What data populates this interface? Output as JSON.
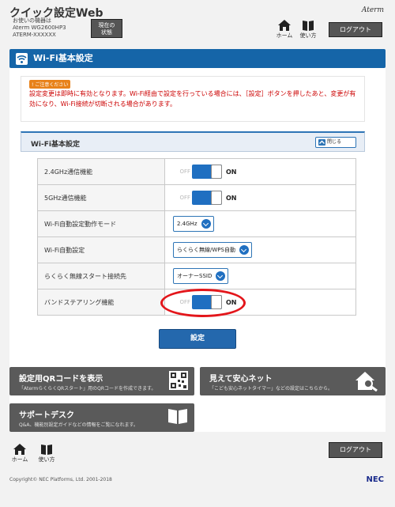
{
  "header": {
    "app_title": "クイック設定Web",
    "device_lines": [
      "お使いの機器は",
      "Aterm WG2600HP3",
      "ATERM-XXXXXX"
    ],
    "status_button": [
      "現在の",
      "状態"
    ],
    "brand": "Aterm",
    "home_label": "ホーム",
    "help_label": "使い方",
    "logout_label": "ログアウト"
  },
  "page_title": "Wi-Fi基本設定",
  "caution": {
    "badge": "ご注意ください",
    "text": "設定変更は即時に有効となります。Wi-Fi経由で設定を行っている場合には、［設定］ボタンを押したあと、変更が有効になり、Wi-Fi接続が切断される場合があります。"
  },
  "section": {
    "title": "Wi-Fi基本設定",
    "close_label": "閉じる"
  },
  "settings": {
    "row0": {
      "label": "2.4GHz通信機能",
      "off": "OFF",
      "on": "ON",
      "enabled": true
    },
    "row1": {
      "label": "5GHz通信機能",
      "off": "OFF",
      "on": "ON",
      "enabled": true
    },
    "row2": {
      "label": "Wi-Fi自動設定動作モード",
      "value": "2.4GHz"
    },
    "row3": {
      "label": "Wi-Fi自動設定",
      "value": "らくらく無線/WPS自動"
    },
    "row4": {
      "label": "らくらく無線スタート接続先",
      "value": "オーナーSSID"
    },
    "row5": {
      "label": "バンドステアリング機能",
      "off": "OFF",
      "on": "ON",
      "enabled": true
    }
  },
  "apply_button": "設定",
  "cards": {
    "qr": {
      "title": "設定用QRコードを表示",
      "desc": "「AtermらくらくQRスタート」用のQRコードを作成できます。",
      "icon": "qr-code-icon"
    },
    "safe": {
      "title": "見えて安心ネット",
      "desc": "「こども安心ネットタイマー」などの設定はこちらから。",
      "icon": "house-search-icon"
    },
    "support": {
      "title": "サポートデスク",
      "desc": "Q&A、機能別設定ガイドなどの情報をご覧になれます。",
      "icon": "book-icon"
    }
  },
  "footer": {
    "home_label": "ホーム",
    "help_label": "使い方",
    "logout_label": "ログアウト",
    "copyright": "Copyright© NEC Platforms, Ltd. 2001-2018",
    "logo": "NEC"
  },
  "colors": {
    "accent": "#1565a8",
    "highlight": "#e3161b",
    "caution": "#cc0000"
  }
}
